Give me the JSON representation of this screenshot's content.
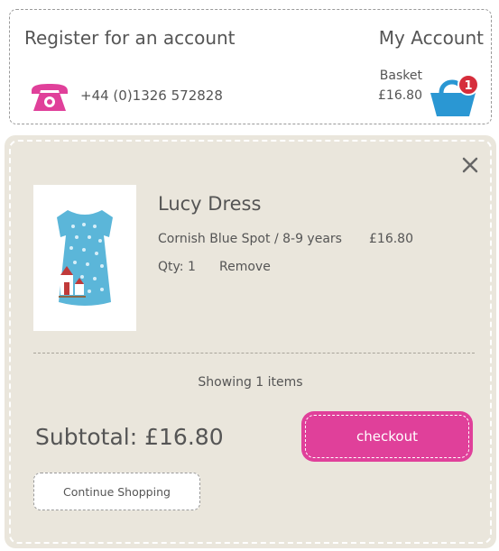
{
  "header": {
    "register_label": "Register for an account",
    "my_account_label": "My Account",
    "phone": "+44 (0)1326 572828",
    "basket_label": "Basket",
    "basket_total": "£16.80",
    "basket_count": "1"
  },
  "cart": {
    "item": {
      "name": "Lucy Dress",
      "variant": "Cornish Blue Spot / 8-9 years",
      "price": "£16.80",
      "qty": "Qty: 1",
      "remove_label": "Remove"
    },
    "showing_text": "Showing 1 items",
    "subtotal": "Subtotal: £16.80",
    "checkout_label": "checkout",
    "continue_label": "Continue Shopping"
  },
  "colors": {
    "accent_pink": "#e0409a",
    "basket_blue": "#2a97d3",
    "badge_red": "#d62d3b",
    "panel_bg": "#eae6dc"
  },
  "icons": {
    "phone": "phone-icon",
    "basket": "basket-icon",
    "close": "close-icon"
  }
}
